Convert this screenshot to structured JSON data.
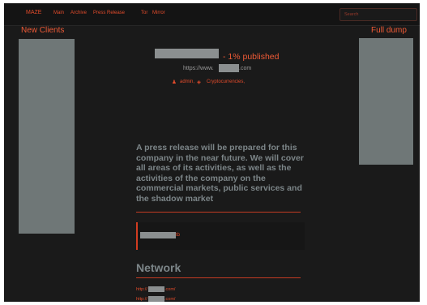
{
  "nav": {
    "brand": "MAZE",
    "links": [
      "Main",
      "Archive",
      "Press Release",
      "Tor",
      "Mirror"
    ],
    "search_placeholder": "Search"
  },
  "left_column": {
    "title": "New Clients"
  },
  "right_column": {
    "title": "Full dump"
  },
  "company": {
    "published_suffix": "- 1% published",
    "url_prefix": "https://www.",
    "url_suffix": ".com",
    "author": "admin,",
    "category": "Cryptocurrencies,"
  },
  "press_release_text": "A press release will be prepared for this company in the near future. We will cover all areas of its activities, as well as the activities of the company on the commercial markets, public services and the shadow market",
  "quote": {
    "suffix": "tb"
  },
  "network": {
    "title": "Network",
    "links": [
      {
        "prefix": "http://",
        "suffix": ".com/"
      },
      {
        "prefix": "http://",
        "suffix": ".com/"
      }
    ]
  },
  "colors": {
    "accent": "#ee5a36",
    "background": "#1a1a1a",
    "muted_text": "#7c8588",
    "panel": "#6f7777"
  }
}
